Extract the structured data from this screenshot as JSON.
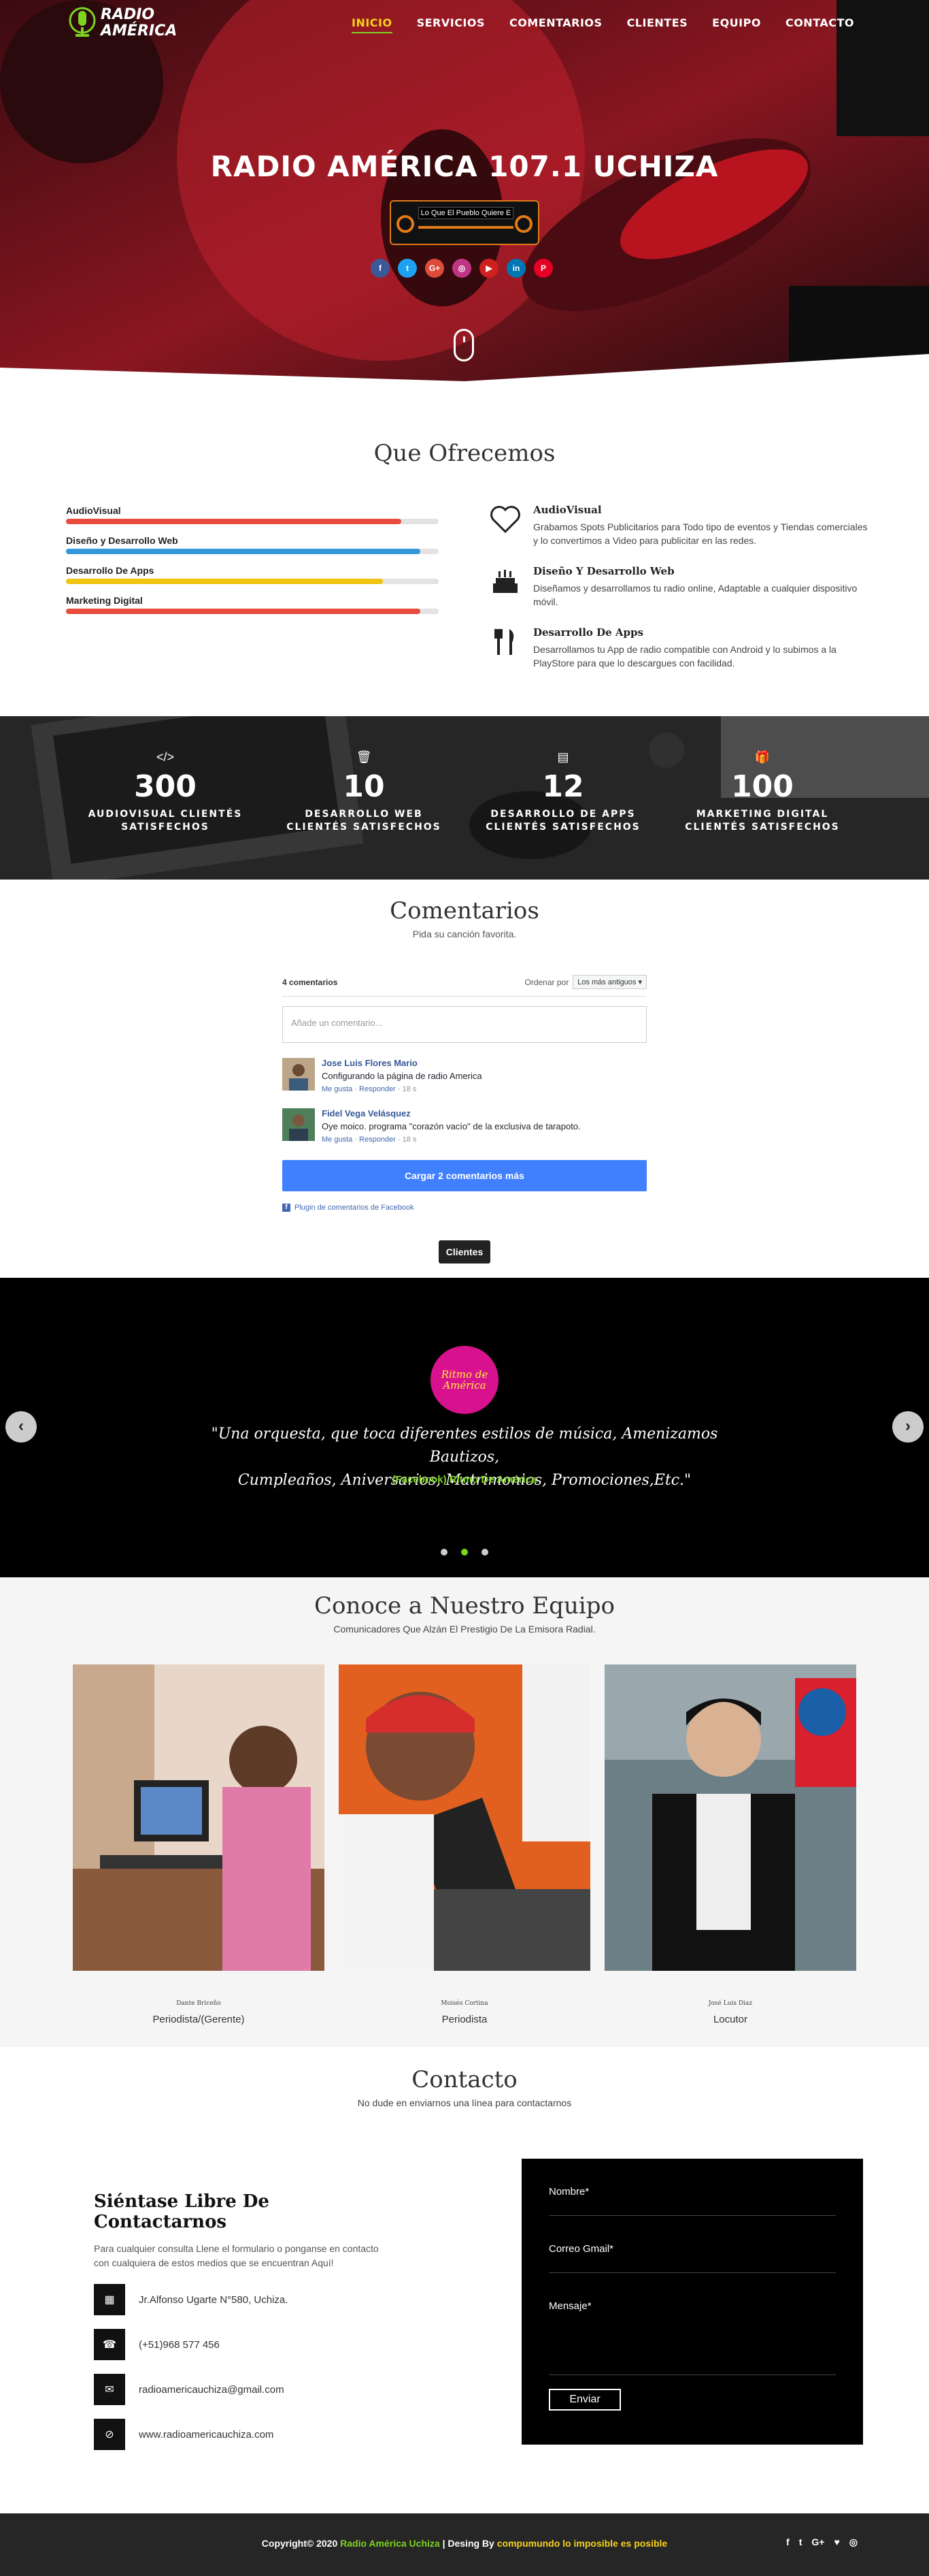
{
  "nav": {
    "logo_line1": "RADIO",
    "logo_line2": "AMÉRICA",
    "items": [
      "INICIO",
      "SERVICIOS",
      "COMENTARIOS",
      "CLIENTES",
      "EQUIPO",
      "CONTACTO"
    ],
    "active": "INICIO"
  },
  "hero": {
    "title": "RADIO AMÉRICA 107.1 UCHIZA",
    "player_text": "Lo Que El Pueblo Quiere E",
    "socials": [
      {
        "icon": "facebook-icon",
        "glyph": "f",
        "color": "#3b5998"
      },
      {
        "icon": "twitter-icon",
        "glyph": "t",
        "color": "#1da1f2"
      },
      {
        "icon": "google-plus-icon",
        "glyph": "G+",
        "color": "#dd4b39"
      },
      {
        "icon": "instagram-icon",
        "glyph": "◎",
        "color": "#c13584"
      },
      {
        "icon": "youtube-icon",
        "glyph": "▶",
        "color": "#cd201f"
      },
      {
        "icon": "linkedin-icon",
        "glyph": "in",
        "color": "#0077b5"
      },
      {
        "icon": "pinterest-icon",
        "glyph": "P",
        "color": "#e60023"
      }
    ]
  },
  "offer": {
    "title": "Que Ofrecemos",
    "skills": [
      {
        "label": "AudioVisual",
        "level": 0.9,
        "color": "#e74c3c"
      },
      {
        "label": "Diseño y Desarrollo Web",
        "level": 0.95,
        "color": "#3498db"
      },
      {
        "label": "Desarrollo De Apps",
        "level": 0.85,
        "color": "#f1c40f"
      },
      {
        "label": "Marketing Digital",
        "level": 0.95,
        "color": "#e74c3c"
      }
    ],
    "services": [
      {
        "title": "AudioVisual",
        "icon": "heart-icon",
        "text": "Grabamos Spots Publicitarios para Todo tipo de eventos y Tiendas comerciales y lo convertimos a Video para publicitar en las redes."
      },
      {
        "title": "Diseño Y Desarrollo Web",
        "icon": "cake-icon",
        "text": "Diseñamos y desarrollamos tu radio online, Adaptable a cualquier dispositivo móvil."
      },
      {
        "title": "Desarrollo De Apps",
        "icon": "cutlery-icon",
        "text": "Desarrollamos tu App de radio compatible con Android y lo subimos a la PlayStore para que lo descargues con facilidad."
      }
    ]
  },
  "stats": [
    {
      "icon": "code-icon",
      "glyph": "</>",
      "number": "300",
      "label1": "AUDIOVISUAL CLIENTÉS",
      "label2": "SATISFECHOS"
    },
    {
      "icon": "trash-icon",
      "glyph": "🗑",
      "number": "10",
      "label1": "DESARROLLO WEB",
      "label2": "CLIENTÉS SATISFECHOS"
    },
    {
      "icon": "book-icon",
      "glyph": "▤",
      "number": "12",
      "label1": "DESARROLLO DE APPS",
      "label2": "CLIENTÉS SATISFECHOS"
    },
    {
      "icon": "gift-icon",
      "glyph": "🎁",
      "number": "100",
      "label1": "MARKETING DIGITAL",
      "label2": "CLIENTÉS SATISFECHOS"
    }
  ],
  "comments": {
    "title": "Comentarios",
    "subtitle": "Pida su canción favorita.",
    "count": "4 comentarios",
    "sort_label": "Ordenar por",
    "sort_value": "Los más antiguos ▾",
    "placeholder": "Añade un comentario...",
    "items": [
      {
        "name": "Jose Luis Flores Mario",
        "text": "Configurando la página de radio America",
        "like": "Me gusta",
        "reply": "Responder",
        "time": "18 s"
      },
      {
        "name": "Fidel Vega Velásquez",
        "text": "Oye moico. programa \"corazón vacío\" de la exclusiva de tarapoto.",
        "like": "Me gusta",
        "reply": "Responder",
        "time": "18 s"
      }
    ],
    "load_more": "Cargar 2 comentarios más",
    "plugin": "Plugin de comentarios de Facebook",
    "clients_button": "Clientes"
  },
  "testimonial": {
    "logo_text": "Ritmo de América",
    "quote_line1": "\"Una orquesta, que toca diferentes estilos de música, Amenizamos Bautizos,",
    "quote_line2": "Cumpleaños, Aniversarios, Matrimonios, Promociones,Etc.\"",
    "source": "(Facebook) Ritmo De América",
    "prev": "‹",
    "next": "›"
  },
  "team": {
    "title": "Conoce a Nuestro Equipo",
    "subtitle": "Comunicadores Que Alzán El Prestigio De La Emisora Radial.",
    "members": [
      {
        "name": "Dante Briceño",
        "role": "Periodista/(Gerente)"
      },
      {
        "name": "Moisés Cortina",
        "role": "Periodista"
      },
      {
        "name": "José Luis Diaz",
        "role": "Locutor"
      }
    ]
  },
  "contact": {
    "title": "Contacto",
    "subtitle": "No dude en enviarnos una línea para contactarnos",
    "heading": "Siéntase Libre De Contactarnos",
    "text": "Para cualquier consulta Llene el formulario o ponganse en contacto con cualquiera de estos medios que se encuentran Aquí!",
    "address": "Jr.Alfonso Ugarte N°580, Uchiza.",
    "phone": "(+51)968 577 456",
    "email": "radioamericauchiza@gmail.com",
    "web": "www.radioamericauchiza.com",
    "form": {
      "name": "Nombre*",
      "email": "Correo Gmail*",
      "message": "Mensaje*",
      "send": "Enviar"
    }
  },
  "footer": {
    "copy": "Copyright© 2020",
    "site": "Radio América Uchiza",
    "design": "| Desing By",
    "author": "compumundo lo imposible es posible",
    "socials": [
      "f",
      "t",
      "G+",
      "♥",
      "◎"
    ]
  }
}
